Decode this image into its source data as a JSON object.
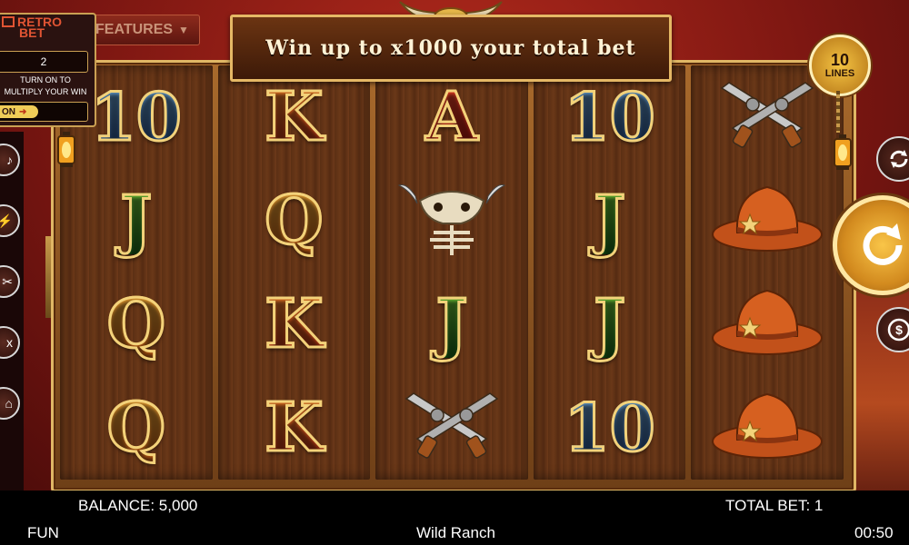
{
  "game": {
    "title": "Wild Ranch"
  },
  "banner": {
    "text": "Win up to x1000 your total bet"
  },
  "features": {
    "label": "FEATURES"
  },
  "retro_bet": {
    "logo_line1": "RETRO",
    "logo_line2": "BET",
    "value": "2",
    "description": "TURN ON TO MULTIPLY YOUR WIN",
    "toggle_label": "ON"
  },
  "lines": {
    "number": "10",
    "label": "LINES"
  },
  "reels": [
    [
      "10",
      "J",
      "Q",
      "Q"
    ],
    [
      "K",
      "Q",
      "K",
      "K"
    ],
    [
      "A",
      "skull",
      "J",
      "revolvers"
    ],
    [
      "10",
      "J",
      "J",
      "10"
    ],
    [
      "revolvers",
      "hat",
      "hat",
      "hat"
    ]
  ],
  "controls": {
    "autoplay_icon": "refresh-icon",
    "spin_icon": "spin-arrow-icon",
    "bet_icon": "dollar-coin-icon",
    "left_icons": [
      "sound-icon",
      "lightning-icon",
      "settings-icon",
      "paytable-icon",
      "home-icon"
    ]
  },
  "status": {
    "balance": "BALANCE: 5,000",
    "total_bet": "TOTAL BET: 1",
    "mode": "FUN",
    "time": "00:50"
  },
  "colors": {
    "frame_gold": "#e0b765",
    "background_red": "#9e2016",
    "spin_gold": "#f2b43a"
  }
}
